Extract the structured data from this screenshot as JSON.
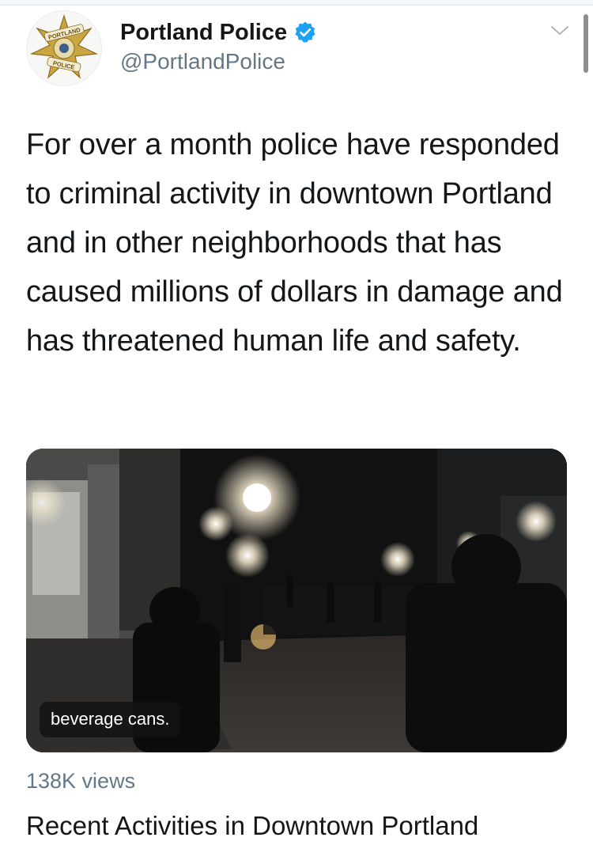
{
  "tweet": {
    "display_name": "Portland Police",
    "handle": "@PortlandPolice",
    "verified": true,
    "text": "For over a month police have responded to criminal activity in downtown Portland and in other neighborhoods that has caused millions of dollars in damage and has threatened human life and safety."
  },
  "avatar": {
    "badge_top_text": "PORTLAND",
    "badge_bottom_text": "POLICE"
  },
  "media": {
    "caption": "beverage cans.",
    "views": "138K views",
    "title": "Recent Activities in Downtown Portland"
  },
  "icons": {
    "verified": "verified-badge-icon",
    "menu": "chevron-down-icon"
  },
  "colors": {
    "text": "#14171a",
    "secondary_text": "#657786",
    "verified_blue": "#1da1f2",
    "badge_gold": "#c9a642"
  }
}
